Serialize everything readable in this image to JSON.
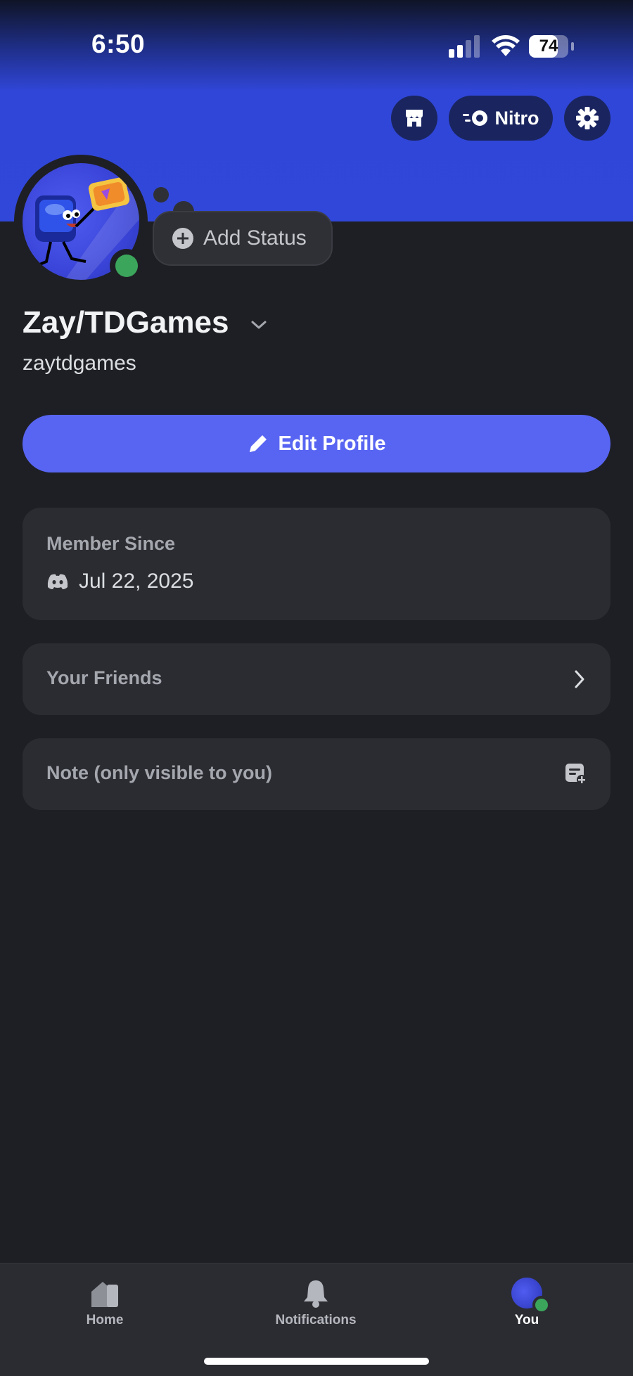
{
  "status_bar": {
    "time": "6:50",
    "battery": "74",
    "battery_level": 0.74
  },
  "header": {
    "nitro_label": "Nitro"
  },
  "profile": {
    "add_status_label": "Add Status",
    "display_name": "Zay/TDGames",
    "username": "zaytdgames",
    "status": "online"
  },
  "actions": {
    "edit_profile_label": "Edit Profile"
  },
  "member_since": {
    "title": "Member Since",
    "date": "Jul 22, 2025"
  },
  "friends": {
    "label": "Your Friends"
  },
  "note": {
    "label": "Note (only visible to you)"
  },
  "tabbar": {
    "items": [
      {
        "label": "Home",
        "icon": "home-icon"
      },
      {
        "label": "Notifications",
        "icon": "bell-icon"
      },
      {
        "label": "You",
        "icon": "avatar",
        "active": true
      }
    ]
  },
  "colors": {
    "banner": "#3147d9",
    "accent": "#5865f2",
    "online": "#3ba55c",
    "background": "#1e1f24",
    "card": "#2b2c32"
  }
}
